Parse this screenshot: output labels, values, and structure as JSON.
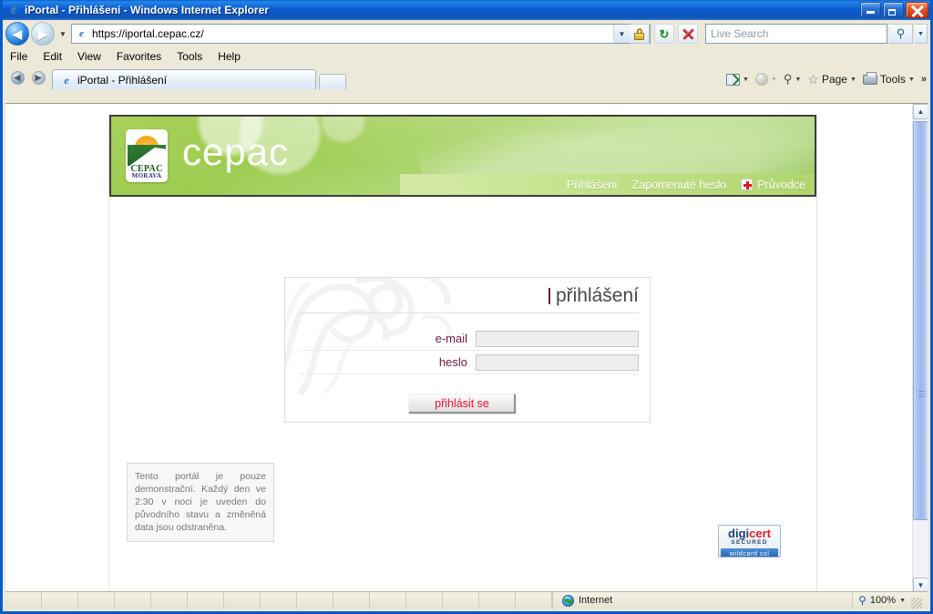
{
  "window": {
    "title": "iPortal - Přihlášení - Windows Internet Explorer",
    "minimize_label": "Minimize",
    "maximize_label": "Maximize",
    "close_label": "Close"
  },
  "browser": {
    "back_glyph": "◀",
    "forward_glyph": "▶",
    "history_caret": "▼",
    "url": "https://iportal.cepac.cz/",
    "address_dropdown_caret": "▼",
    "lock_icon": "lock-icon",
    "refresh_glyph": "↻",
    "stop_label": "Stop",
    "search_placeholder": "Live Search",
    "search_value": "",
    "search_go_glyph": "⚲",
    "search_dropdown_caret": "▼",
    "menu": [
      "File",
      "Edit",
      "View",
      "Favorites",
      "Tools",
      "Help"
    ],
    "tabs": [
      {
        "label": "iPortal - Přihlášení",
        "active": true
      }
    ],
    "quick_back_glyph": "◀",
    "quick_fwd_glyph": "▶",
    "commands": [
      {
        "name": "feeds",
        "label": "",
        "caret": "▼"
      },
      {
        "name": "rss",
        "label": "",
        "caret": "▼"
      },
      {
        "name": "search",
        "label": "",
        "caret": "▼"
      },
      {
        "name": "page",
        "label": "Page",
        "caret": "▼"
      },
      {
        "name": "tools",
        "label": "Tools",
        "caret": "▼"
      }
    ],
    "overflow_glyph": "»"
  },
  "page": {
    "brand": {
      "wordmark": "cepac",
      "logo_line1": "CEPAC",
      "logo_line2": "MORAVA"
    },
    "nav": [
      {
        "label": "Přihlášení"
      },
      {
        "label": "Zapomenuté heslo"
      },
      {
        "label": "Průvodce",
        "icon": "red-cross-icon"
      }
    ],
    "login": {
      "title": "přihlášení",
      "fields": [
        {
          "label": "e-mail",
          "value": "",
          "placeholder": ""
        },
        {
          "label": "heslo",
          "value": "",
          "placeholder": ""
        }
      ],
      "submit_label": "přihlásit se"
    },
    "note": "Tento portál je pouze demonstrační. Každý den ve 2:30 v noci je uveden do původního stavu a změněná data jsou odstraněna.",
    "digicert": {
      "word1": "digi",
      "word2": "cert",
      "secured": "SECURED",
      "bar": "wildcard ssl"
    }
  },
  "statusbar": {
    "zone": "Internet",
    "zoom": "100%",
    "zoom_caret": "▼"
  },
  "colors": {
    "brand_green": "#8cc63f",
    "nav_strip_green": "#c7e490",
    "label_maroon": "#6b1840",
    "button_red": "#e8112d",
    "titlebar_blue": "#0a59c8",
    "digicert_red": "#d81f26",
    "digicert_navy": "#1c3f6e"
  }
}
